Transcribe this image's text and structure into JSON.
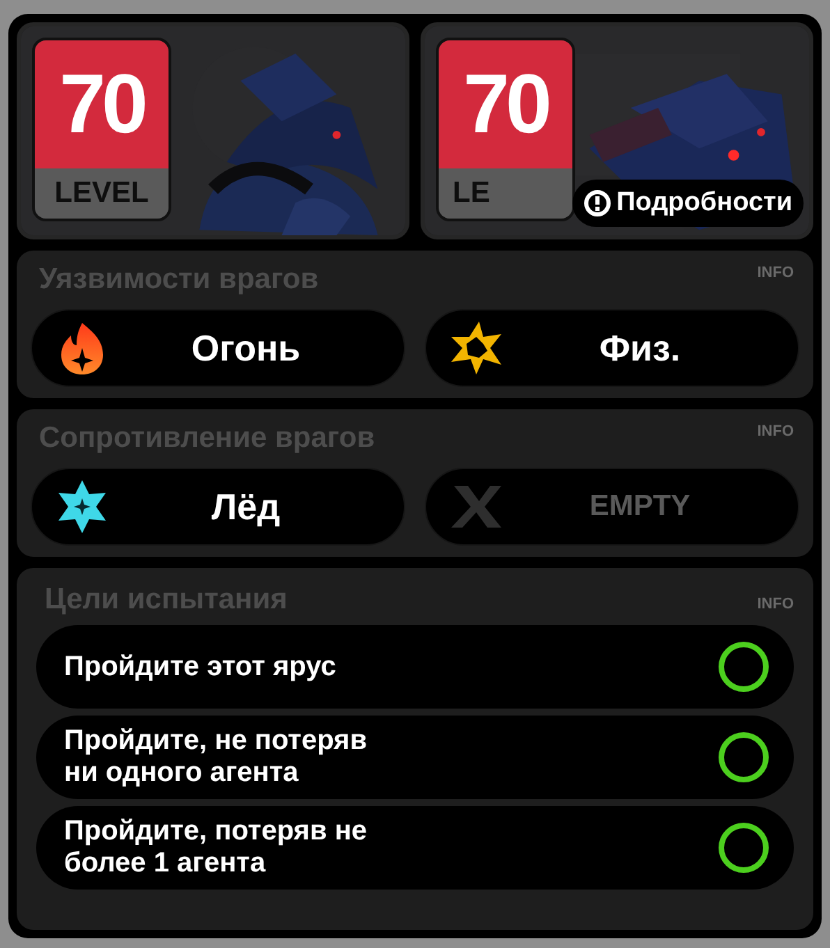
{
  "enemies": [
    {
      "level": "70",
      "level_label": "LEVEL"
    },
    {
      "level": "70",
      "level_label": "LE",
      "details_button": "Подробности"
    }
  ],
  "sections": [
    {
      "title": "Уязвимости врагов",
      "info": "INFO",
      "slots": [
        {
          "kind": "fire",
          "label": "Огонь"
        },
        {
          "kind": "physical",
          "label": "Физ."
        }
      ]
    },
    {
      "title": "Сопротивление врагов",
      "info": "INFO",
      "slots": [
        {
          "kind": "ice",
          "label": "Лёд"
        },
        {
          "kind": "empty",
          "label": "EMPTY"
        }
      ]
    }
  ],
  "objectives": {
    "title": "Цели испытания",
    "info": "INFO",
    "items": [
      {
        "text": "Пройдите этот ярус",
        "checked": false
      },
      {
        "text": "Пройдите, не потеряв ни одного агента",
        "checked": false
      },
      {
        "text": "Пройдите, потеряв не более 1 агента",
        "checked": false
      }
    ]
  }
}
